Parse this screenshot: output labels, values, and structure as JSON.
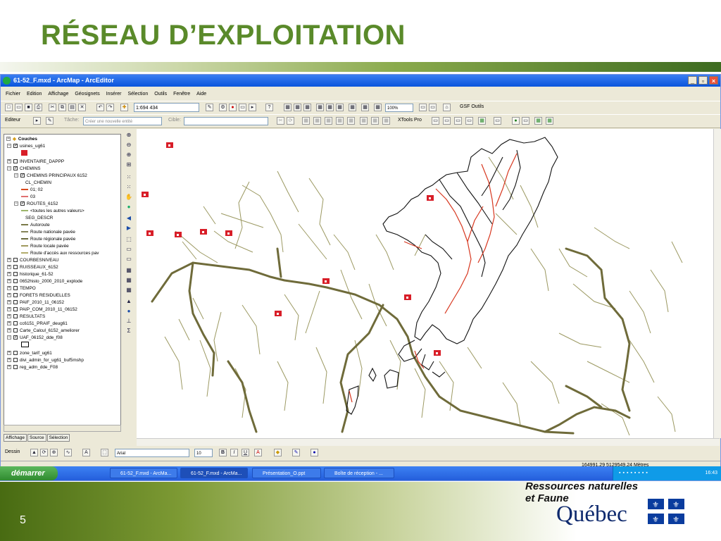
{
  "slide": {
    "title": "RÉSEAU D’EXPLOITATION",
    "page_number": "5",
    "footer_org_line1": "Ressources naturelles",
    "footer_org_line2": "et Faune",
    "footer_gov": "Québec"
  },
  "app": {
    "window_title": "61-52_F.mxd - ArcMap - ArcEditor",
    "window_controls": [
      "_",
      "▫",
      "×"
    ],
    "menu": [
      "Fichier",
      "Edition",
      "Affichage",
      "Géosignets",
      "Insérer",
      "Sélection",
      "Outils",
      "Fenêtre",
      "Aide"
    ],
    "toolbar": {
      "scale": "1:694 434",
      "zoom_percent": "100%",
      "gsf_tools": "GSF Outils",
      "editor": "Editeur",
      "task_label": "Tâche:",
      "task_value": "Créer une nouvelle entité",
      "target_label": "Cible:",
      "xtools": "XTools Pro"
    },
    "toc": {
      "root": "Couches",
      "items": [
        {
          "label": "usines_ug61",
          "level": 1,
          "checked": true,
          "expand": "-"
        },
        {
          "label": "INVENTAIRE_DAPPP",
          "level": 1,
          "checked": false,
          "expand": "+"
        },
        {
          "label": "CHEMINS",
          "level": 1,
          "checked": true,
          "expand": "-"
        },
        {
          "label": "CHEMINS PRINCIPAUX 6152",
          "level": 2,
          "checked": true,
          "expand": "-"
        },
        {
          "label": "CL_CHEMIN",
          "level": 4
        },
        {
          "label": "01; 02",
          "level": 3,
          "symbol": "#d94a1e"
        },
        {
          "label": "03",
          "level": 3,
          "symbol": "#e07070"
        },
        {
          "label": "ROUTES_6152",
          "level": 2,
          "checked": true,
          "expand": "-"
        },
        {
          "label": "<toutes les autres valeurs>",
          "level": 3,
          "symbol": "#9db56a"
        },
        {
          "label": "SEG_DESCR",
          "level": 4
        },
        {
          "label": "Autoroute",
          "level": 3,
          "symbol": "#7a7a48"
        },
        {
          "label": "Route nationale pavée",
          "level": 3,
          "symbol": "#86855a"
        },
        {
          "label": "Route régionale pavée",
          "level": 3,
          "symbol": "#6c6c40"
        },
        {
          "label": "Route locale pavée",
          "level": 3,
          "symbol": "#a09a5e"
        },
        {
          "label": "Route d'accès aux ressources pav",
          "level": 3,
          "symbol": "#b3ad6c"
        },
        {
          "label": "COURBESNIVEAU",
          "level": 1,
          "checked": false,
          "expand": "+"
        },
        {
          "label": "RUISSEAUX_6152",
          "level": 1,
          "checked": false,
          "expand": "+"
        },
        {
          "label": "historique_61-52",
          "level": 1,
          "checked": false,
          "expand": "+"
        },
        {
          "label": "0652histo_2000_2010_explode",
          "level": 1,
          "checked": false,
          "expand": "+"
        },
        {
          "label": "TEMPO",
          "level": 1,
          "checked": false,
          "expand": "+"
        },
        {
          "label": "FORETS RESIDUELLES",
          "level": 1,
          "checked": false,
          "expand": "+"
        },
        {
          "label": "PAIF_2010_11_06152",
          "level": 1,
          "checked": false,
          "expand": "+"
        },
        {
          "label": "PAIP_COM_2010_11_06152",
          "level": 1,
          "checked": false,
          "expand": "+"
        },
        {
          "label": "RESULTATS",
          "level": 1,
          "checked": false,
          "expand": "+"
        },
        {
          "label": "cc6151_PRAIF_deug61",
          "level": 1,
          "checked": false,
          "expand": "+"
        },
        {
          "label": "Carte_Calcul_6152_ameliorer",
          "level": 1,
          "checked": false,
          "expand": "+"
        },
        {
          "label": "UAF_06152_dde_f08",
          "level": 1,
          "checked": true,
          "expand": "-"
        },
        {
          "label": "zone_tarif_ug61",
          "level": 1,
          "checked": false,
          "expand": "+"
        },
        {
          "label": "divi_admin_for_ug61_buf5mshp",
          "level": 1,
          "checked": false,
          "expand": "+"
        },
        {
          "label": "reg_adm_dde_F08",
          "level": 1,
          "checked": false,
          "expand": "+"
        }
      ],
      "tabs": [
        "Affichage",
        "Source",
        "Sélection"
      ]
    },
    "drawing": {
      "dessin": "Dessin",
      "font": "Arial",
      "size": "10"
    },
    "status_coords": "164991,29  5129549,24 Mètres"
  },
  "taskbar": {
    "start": "démarrer",
    "tasks": [
      "61-52_F.mxd - ArcMa...",
      "61-52_F.mxd - ArcMa...",
      "Présentation_O.ppt",
      "Boîte de réception - ..."
    ],
    "clock": "16:43"
  },
  "colors": {
    "title_green": "#5a8a2a",
    "road": "#6f6b3a",
    "red_path": "#d7371f",
    "factory_red": "#d81e28"
  }
}
